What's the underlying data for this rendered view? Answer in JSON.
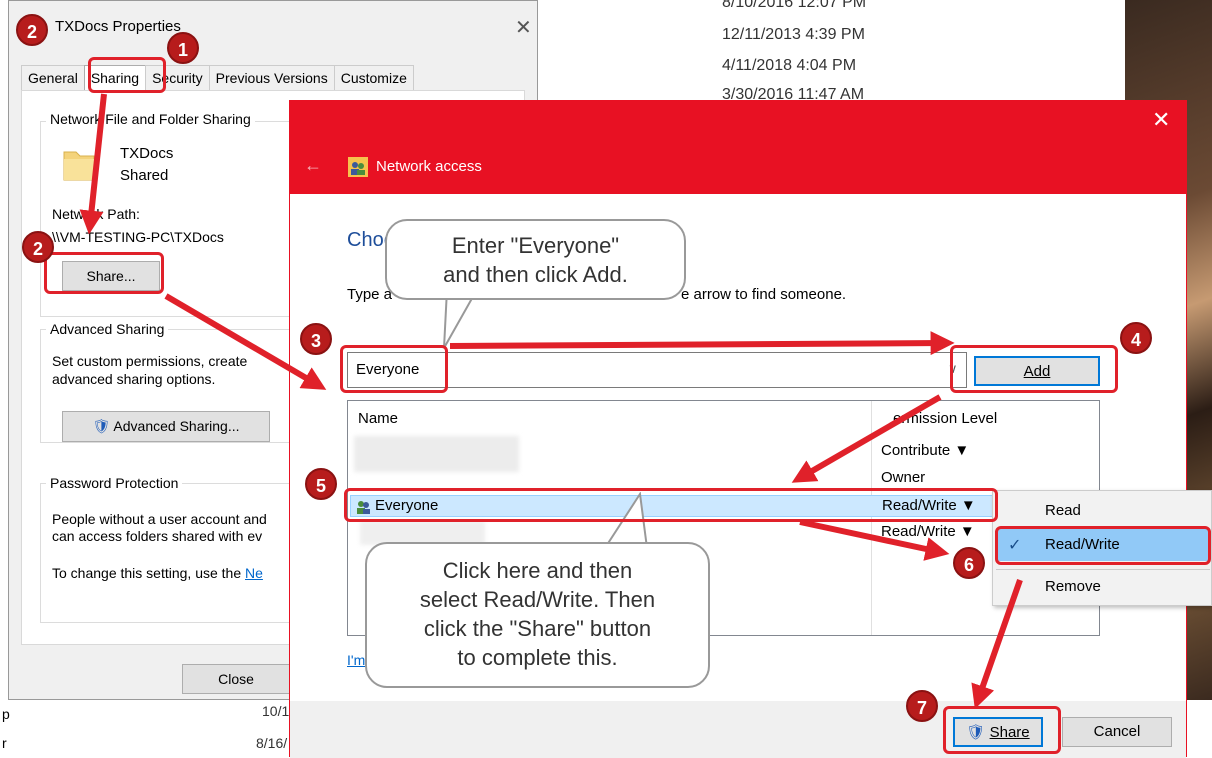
{
  "background": {
    "dates": [
      "8/10/2016 12:07 PM",
      "12/11/2013 4:39 PM",
      "4/11/2018 4:04 PM",
      "3/30/2016 11:47 AM"
    ],
    "bottom_dates": [
      "10/1",
      "8/16/"
    ],
    "left_letters": [
      "p",
      "r"
    ]
  },
  "props": {
    "title": "TXDocs Properties",
    "close": "✕",
    "tabs": [
      "General",
      "Sharing",
      "Security",
      "Previous Versions",
      "Customize"
    ],
    "network_group": "Network File and Folder Sharing",
    "folder_name": "TXDocs",
    "folder_state": "Shared",
    "path_label": "Network Path:",
    "path_value": "\\\\VM-TESTING-PC\\TXDocs",
    "share_button": "Share...",
    "advanced_group": "Advanced Sharing",
    "advanced_text_1": "Set custom permissions, create",
    "advanced_text_2": "advanced sharing options.",
    "advanced_button": "Advanced Sharing...",
    "password_group": "Password Protection",
    "password_text_1": "People without a user account and",
    "password_text_2": "can access folders shared with ev",
    "password_text_3": "To change this setting, use the",
    "password_link": "Ne",
    "close_button": "Close"
  },
  "network": {
    "title": "Network access",
    "close": "✕",
    "back": "←",
    "heading": "Choo",
    "instructions_start": "Type a",
    "instructions_end": "e arrow to find someone.",
    "input_value": "Everyone",
    "add_button": "Add",
    "col_name": "Name",
    "col_permission": "ermission Level",
    "rows": [
      {
        "name": "",
        "permission": "Contribute ▼"
      },
      {
        "name": "",
        "permission": "Owner"
      },
      {
        "name": "Everyone",
        "permission": "Read/Write ▼"
      },
      {
        "name": "",
        "permission": "Read/Write ▼"
      }
    ],
    "help_link": "I'm",
    "share_button": "Share",
    "cancel_button": "Cancel"
  },
  "menu": {
    "items": [
      "Read",
      "Read/Write",
      "Remove"
    ],
    "checked": "✓"
  },
  "callouts": {
    "add_1": "Enter \"Everyone\"",
    "add_2": "and then click Add.",
    "rw_1": "Click here and then",
    "rw_2": "select Read/Write.  Then",
    "rw_3": "click the \"Share\" button",
    "rw_4": "to complete this."
  },
  "badges": [
    "2",
    "1",
    "2",
    "3",
    "4",
    "5",
    "6",
    "7"
  ],
  "colors": {
    "accent_red": "#e81123",
    "annotation_red": "#e0212a",
    "selection": "#cce8ff"
  }
}
